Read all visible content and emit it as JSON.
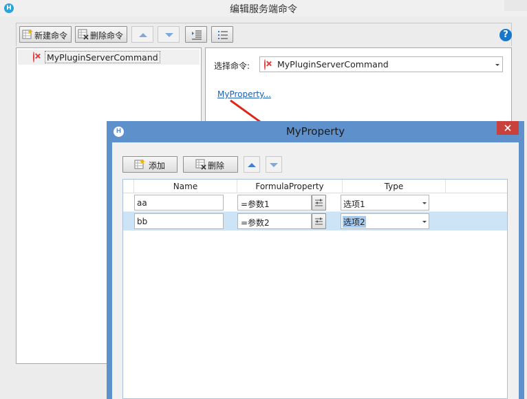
{
  "main_window": {
    "title": "编辑服务端命令",
    "toolbar": {
      "new_command": "新建命令",
      "delete_command": "删除命令"
    },
    "tree_item": "MyPluginServerCommand",
    "select_label": "选择命令:",
    "selected_command": "MyPluginServerCommand",
    "property_link": "MyProperty..."
  },
  "dialog": {
    "title": "MyProperty",
    "add_label": "添加",
    "delete_label": "删除",
    "columns": [
      "Name",
      "FormulaProperty",
      "Type"
    ],
    "rows": [
      {
        "name": "aa",
        "formula": "=参数1",
        "type": "选项1"
      },
      {
        "name": "bb",
        "formula": "=参数2",
        "type": "选项2"
      }
    ]
  },
  "colors": {
    "dialog_border": "#5b8cc6",
    "selected_row": "#cde4f7",
    "close_button": "#c9413c",
    "link": "#1a5fb4",
    "callout_arrow": "#e0261b"
  }
}
